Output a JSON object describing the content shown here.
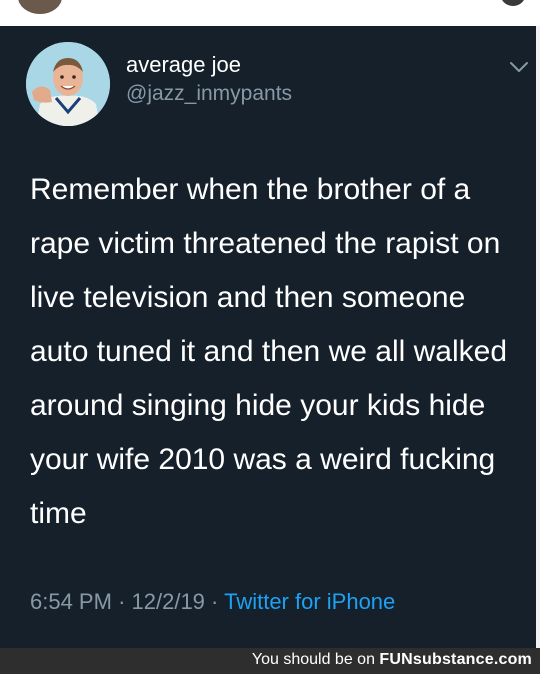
{
  "tweet": {
    "display_name": "average joe",
    "handle": "@jazz_inmypants",
    "text": "Remember when the brother of a rape victim threatened the rapist on live television and then someone auto tuned it and then we all walked around singing hide your kids hide your wife 2010 was a weird fucking time",
    "time": "6:54 PM",
    "separator": "·",
    "date": "12/2/19",
    "source": "Twitter for iPhone",
    "menu_icon": "chevron-down-icon"
  },
  "footer": {
    "prefix": "You should be on",
    "brand": "FUNsubstance.com"
  },
  "colors": {
    "card_background": "#15202b",
    "primary_text": "#ffffff",
    "secondary_text": "#8899a6",
    "link": "#1da1f2",
    "footer_background": "#2e2e2e"
  }
}
